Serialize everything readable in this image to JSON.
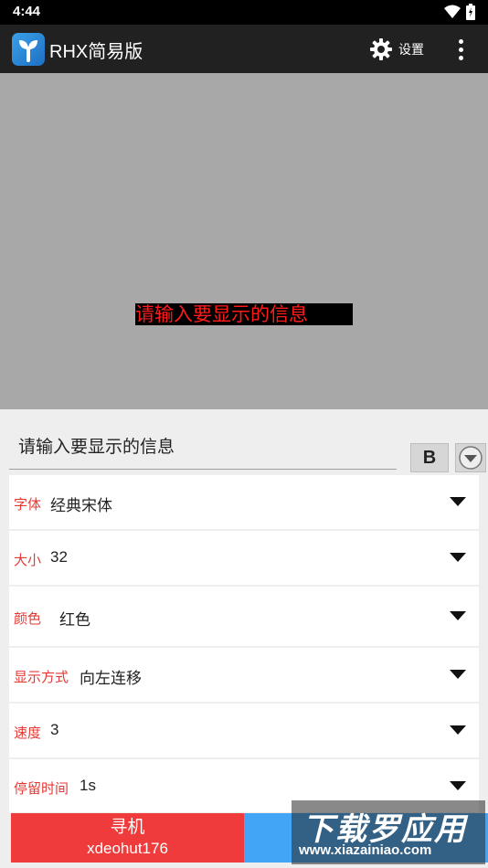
{
  "status_bar": {
    "time": "4:44"
  },
  "app_bar": {
    "title": "RHX简易版",
    "settings_label": "设置"
  },
  "preview": {
    "text": "请输入要显示的信息"
  },
  "editor": {
    "message_value": "请输入要显示的信息",
    "bold_label": "B"
  },
  "options": [
    {
      "label": "字体",
      "value": "经典宋体"
    },
    {
      "label": "大小",
      "value": "32"
    },
    {
      "label": "颜色",
      "value": "红色"
    },
    {
      "label": "显示方式",
      "value": "向左连移"
    },
    {
      "label": "速度",
      "value": "3"
    },
    {
      "label": "停留时间",
      "value": "1s"
    }
  ],
  "bottom": {
    "left_line1": "寻机",
    "left_line2": "xdeohut176"
  },
  "watermark": {
    "big": "下载罗应用",
    "small": "www.xiazainiao.com"
  },
  "colors": {
    "accent_red": "#e53935",
    "preview_text": "#ff1a1a",
    "button_red": "#ef3b3b",
    "button_blue": "#42a5f5"
  }
}
